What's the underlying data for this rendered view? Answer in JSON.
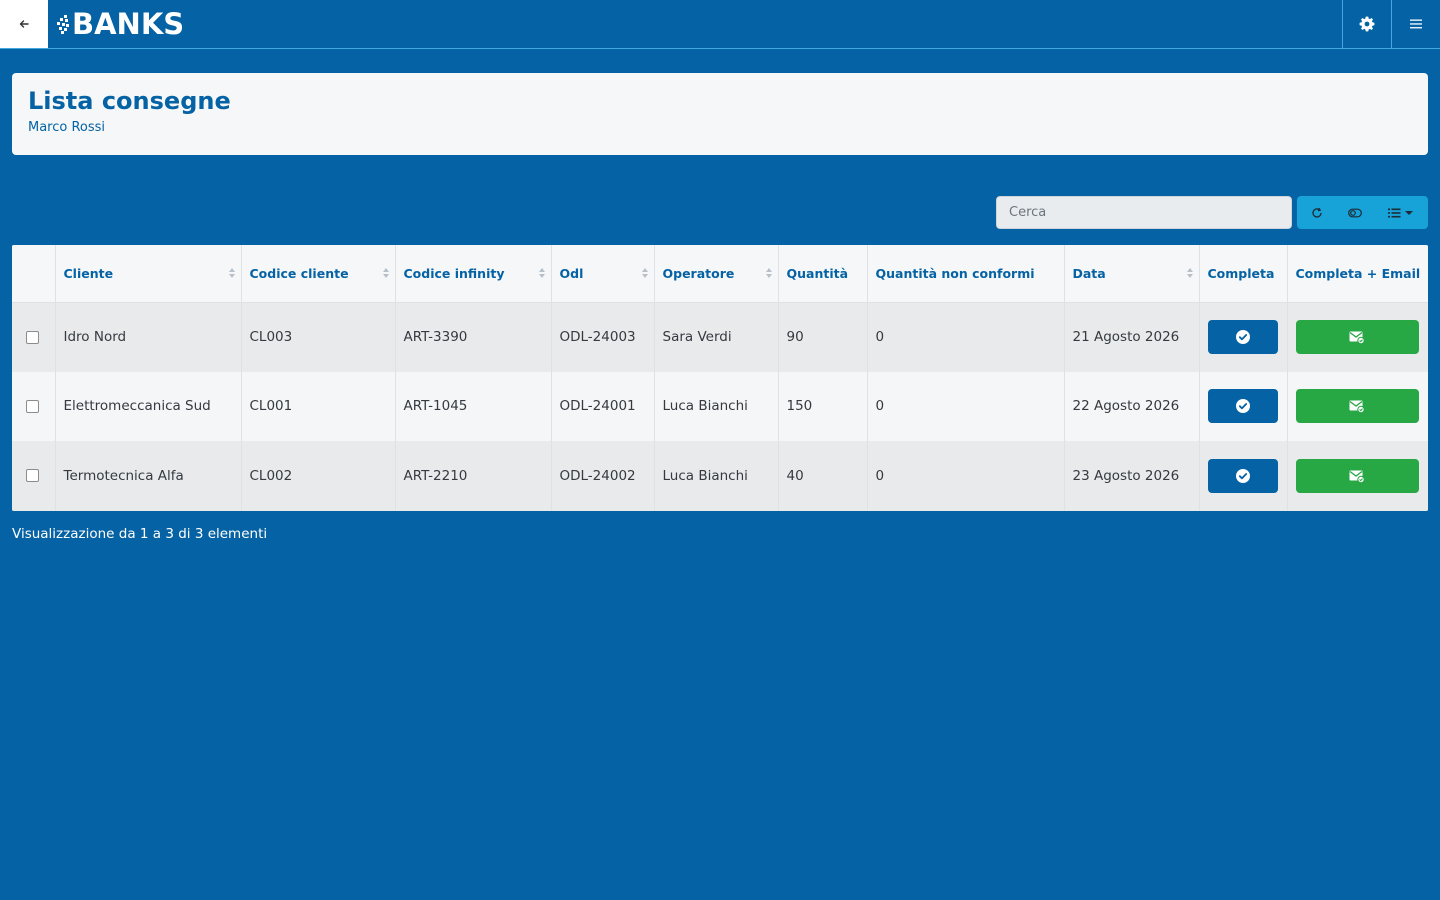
{
  "topbar": {
    "logo_text": "BANKS",
    "icons": [
      "back-arrow-icon",
      "gear-icon",
      "hamburger-menu-icon"
    ]
  },
  "header": {
    "title": "Lista consegne",
    "subtitle": "Marco Rossi"
  },
  "toolbar": {
    "search_placeholder": "Cerca",
    "buttons": [
      "refresh-icon",
      "toggle-icon",
      "columns-list-icon"
    ]
  },
  "table": {
    "columns": [
      {
        "label": ""
      },
      {
        "label": "Cliente"
      },
      {
        "label": "Codice cliente"
      },
      {
        "label": "Codice infinity"
      },
      {
        "label": "Odl"
      },
      {
        "label": "Operatore"
      },
      {
        "label": "Quantità"
      },
      {
        "label": "Quantità non conformi"
      },
      {
        "label": "Data"
      },
      {
        "label": "Completa"
      },
      {
        "label": "Completa + Email"
      }
    ],
    "rows": [
      {
        "cliente": "Idro Nord",
        "codice_cliente": "CL003",
        "codice_infinity": "ART-3390",
        "odl": "ODL-24003",
        "operatore": "Sara Verdi",
        "quantita": "90",
        "non_conformi": "0",
        "data": "21 Agosto 2026"
      },
      {
        "cliente": "Elettromeccanica Sud",
        "codice_cliente": "CL001",
        "codice_infinity": "ART-1045",
        "odl": "ODL-24001",
        "operatore": "Luca Bianchi",
        "quantita": "150",
        "non_conformi": "0",
        "data": "22 Agosto 2026"
      },
      {
        "cliente": "Termotecnica Alfa",
        "codice_cliente": "CL002",
        "codice_infinity": "ART-2210",
        "odl": "ODL-24002",
        "operatore": "Luca Bianchi",
        "quantita": "40",
        "non_conformi": "0",
        "data": "23 Agosto 2026"
      }
    ]
  },
  "footer": {
    "info": "Visualizzazione da 1 a 3 di 3 elementi"
  },
  "colors": {
    "background": "#0562a4",
    "primary": "#0562a4",
    "success": "#28a745",
    "info": "#17a2d8"
  }
}
